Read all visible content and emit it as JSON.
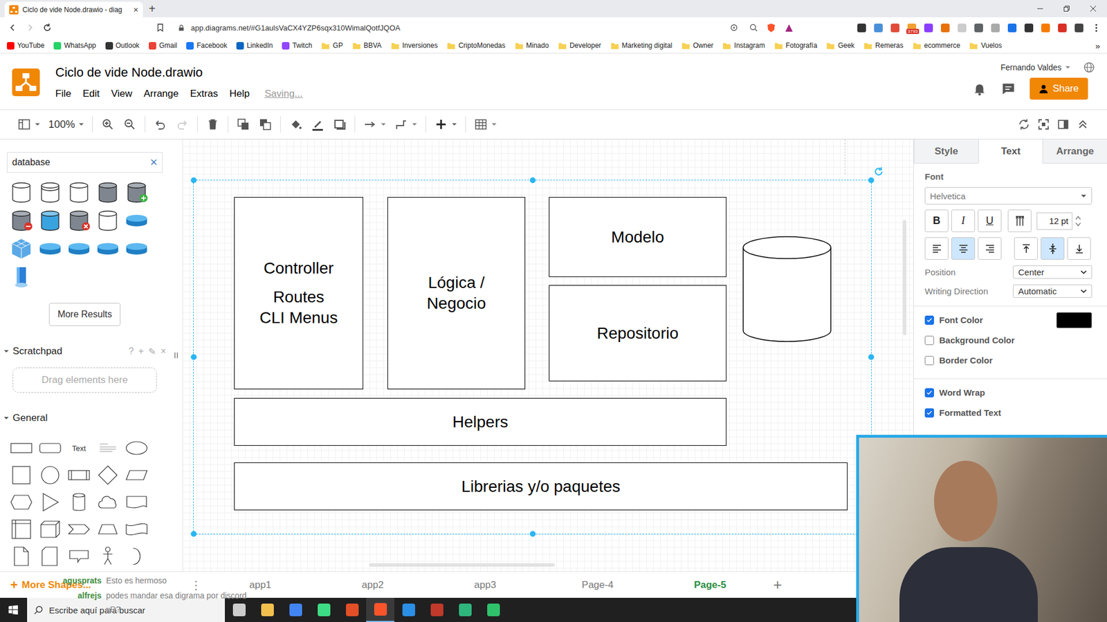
{
  "browser": {
    "tabs": [
      {
        "title": "Ciclo de vide Node.drawio - diag",
        "close": "×",
        "selected": true
      }
    ],
    "new_tab": "+",
    "url": "app.diagrams.net/#G1aulsVaCX4YZP6sqx310WimalQotfJQOA",
    "extension_badge": "3793",
    "bookmarks": [
      {
        "label": "YouTube",
        "kind": "site",
        "color": "#ff0000"
      },
      {
        "label": "WhatsApp",
        "kind": "site",
        "color": "#25d366"
      },
      {
        "label": "Outlook",
        "kind": "site",
        "color": "#333333"
      },
      {
        "label": "Gmail",
        "kind": "site",
        "color": "#ea4335"
      },
      {
        "label": "Facebook",
        "kind": "site",
        "color": "#1877f2"
      },
      {
        "label": "LinkedIn",
        "kind": "site",
        "color": "#0a66c2"
      },
      {
        "label": "Twitch",
        "kind": "site",
        "color": "#9146ff"
      },
      {
        "label": "GP",
        "kind": "folder"
      },
      {
        "label": "BBVA",
        "kind": "folder"
      },
      {
        "label": "Inversiones",
        "kind": "folder"
      },
      {
        "label": "CriptoMonedas",
        "kind": "folder"
      },
      {
        "label": "Minado",
        "kind": "folder"
      },
      {
        "label": "Developer",
        "kind": "folder"
      },
      {
        "label": "Marketing digital",
        "kind": "folder"
      },
      {
        "label": "Owner",
        "kind": "folder"
      },
      {
        "label": "Instagram",
        "kind": "folder"
      },
      {
        "label": "Fotografía",
        "kind": "folder"
      },
      {
        "label": "Geek",
        "kind": "folder"
      },
      {
        "label": "Remeras",
        "kind": "folder"
      },
      {
        "label": "ecommerce",
        "kind": "folder"
      },
      {
        "label": "Vuelos",
        "kind": "folder"
      }
    ],
    "bookmarks_more": "»"
  },
  "app": {
    "title": "Ciclo de vide Node.drawio",
    "menus": [
      "File",
      "Edit",
      "View",
      "Arrange",
      "Extras",
      "Help"
    ],
    "status": "Saving...",
    "user": "Fernando Valdes",
    "share": "Share"
  },
  "toolbar": {
    "zoom": "100%"
  },
  "sidebar": {
    "search": "database",
    "clear": "×",
    "more_results": "More Results",
    "scratchpad": {
      "title": "Scratchpad",
      "expanded": true,
      "actions": [
        "?",
        "+",
        "✎",
        "×"
      ],
      "hint": "Drag elements here"
    },
    "general": {
      "title": "General",
      "expanded": true
    },
    "text_shape": "Text"
  },
  "diagram": {
    "group_selected": true,
    "nodes": [
      {
        "kind": "rect",
        "lines": [
          "Controller",
          "Routes",
          "CLI Menus"
        ]
      },
      {
        "kind": "rect",
        "lines": [
          "Lógica /",
          "Negocio"
        ]
      },
      {
        "kind": "rect",
        "lines": [
          "Modelo"
        ]
      },
      {
        "kind": "rect",
        "lines": [
          "Repositorio"
        ]
      },
      {
        "kind": "cylinder",
        "lines": []
      },
      {
        "kind": "rect",
        "lines": [
          "Helpers"
        ]
      },
      {
        "kind": "rect",
        "lines": [
          "Librerias y/o paquetes"
        ]
      }
    ]
  },
  "pages": {
    "add_shapes": "+",
    "more_shapes": "More Shapes...",
    "menu": "⋮",
    "tabs": [
      {
        "label": "app1",
        "selected": false
      },
      {
        "label": "app2",
        "selected": false
      },
      {
        "label": "app3",
        "selected": false
      },
      {
        "label": "Page-4",
        "selected": false
      },
      {
        "label": "Page-5",
        "selected": true
      }
    ],
    "add": "+"
  },
  "format_panel": {
    "tabs": [
      {
        "label": "Style",
        "selected": false
      },
      {
        "label": "Text",
        "selected": true
      },
      {
        "label": "Arrange",
        "selected": false
      }
    ],
    "font_title": "Font",
    "font": "Helvetica",
    "styles": [
      {
        "label": "B",
        "on": false
      },
      {
        "label": "I",
        "on": false
      },
      {
        "label": "U",
        "on": false
      }
    ],
    "size": "12 pt",
    "h_align": [
      {
        "kind": "left",
        "selected": false
      },
      {
        "kind": "center",
        "selected": true
      },
      {
        "kind": "right",
        "selected": false
      }
    ],
    "v_align": [
      {
        "kind": "top",
        "selected": false
      },
      {
        "kind": "middle",
        "selected": true
      },
      {
        "kind": "bottom",
        "selected": false
      }
    ],
    "selects": [
      {
        "label": "Position",
        "value": "Center"
      },
      {
        "label": "Writing Direction",
        "value": "Automatic"
      }
    ],
    "color_options": [
      {
        "label": "Font Color",
        "checked": true,
        "color": "#000000"
      },
      {
        "label": "Background Color",
        "checked": false
      },
      {
        "label": "Border Color",
        "checked": false
      }
    ],
    "text_options": [
      {
        "label": "Word Wrap",
        "checked": true
      },
      {
        "label": "Formatted Text",
        "checked": true
      }
    ]
  },
  "taskbar": {
    "search": "Escribe aquí para buscar"
  },
  "chat": [
    {
      "user": "agusprats",
      "text": "Esto es hermoso"
    },
    {
      "user": "alfrejs",
      "text": "podes mandar esa digrama por discord xD?"
    }
  ]
}
